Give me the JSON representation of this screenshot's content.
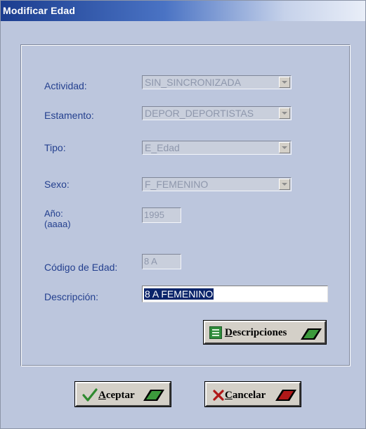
{
  "window": {
    "title": "Modificar Edad"
  },
  "form": {
    "actividad": {
      "label": "Actividad:",
      "value": "SIN_SINCRONIZADA"
    },
    "estamento": {
      "label": "Estamento:",
      "value": "DEPOR_DEPORTISTAS"
    },
    "tipo": {
      "label": "Tipo:",
      "value": "E_Edad"
    },
    "sexo": {
      "label": "Sexo:",
      "value": "F_FEMENINO"
    },
    "anio": {
      "label": "Año:",
      "sublabel": "(aaaa)",
      "value": "1995"
    },
    "codigo": {
      "label": "Código de Edad:",
      "value": "8 A"
    },
    "descripcion": {
      "label": "Descripción:",
      "value": "8 A FEMENINO"
    }
  },
  "buttons": {
    "descripciones": {
      "underline": "D",
      "rest": "escripciones"
    },
    "aceptar": {
      "underline": "A",
      "rest": "ceptar"
    },
    "cancelar": {
      "underline": "C",
      "rest": "ancelar"
    }
  },
  "icons": {
    "list": "list-icon",
    "check": "check-icon",
    "cross": "cross-icon",
    "green_accent": "#3c9a3c",
    "red_accent": "#b01818"
  }
}
